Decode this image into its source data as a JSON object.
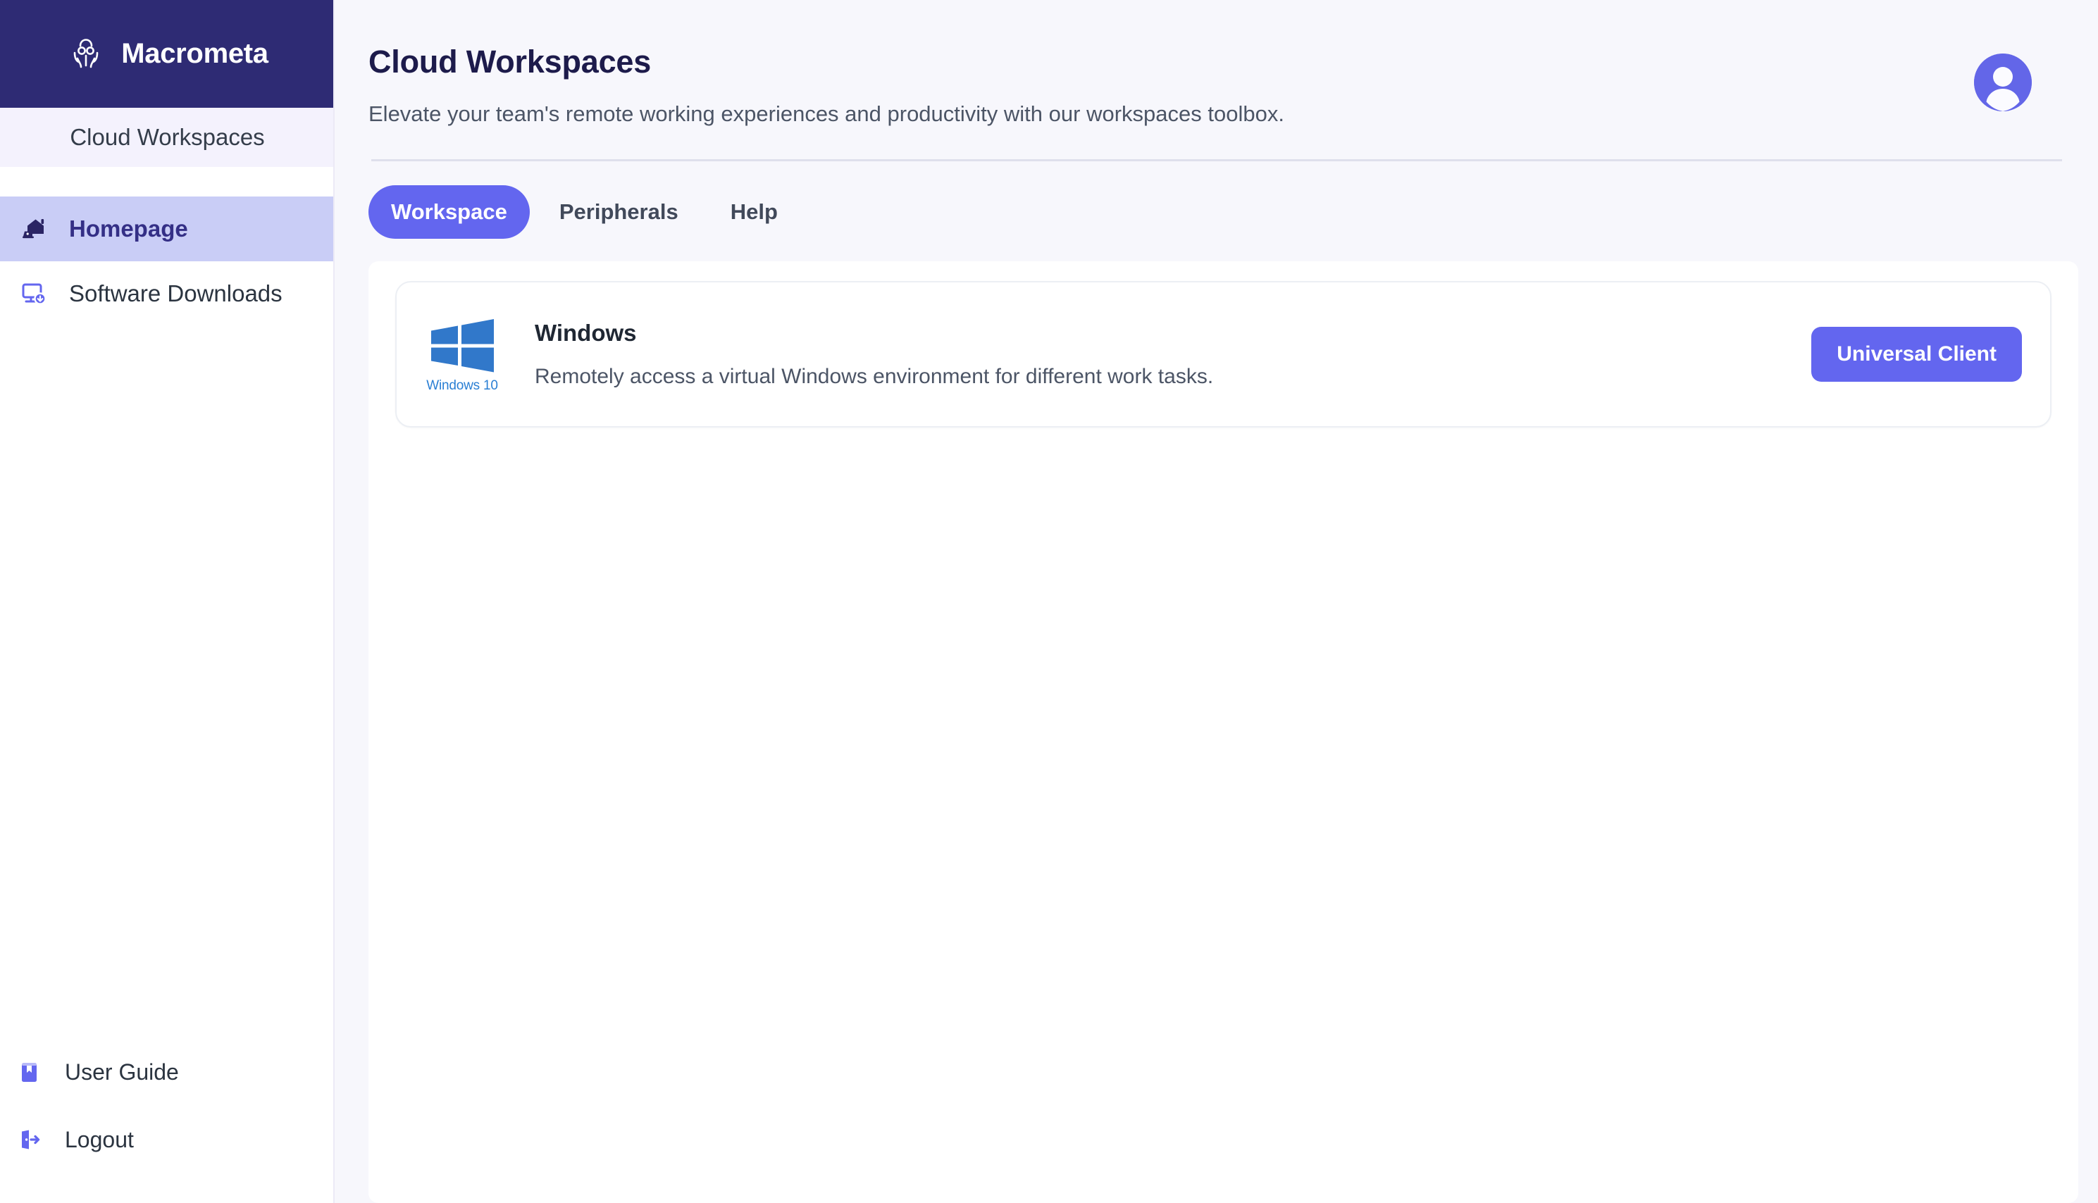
{
  "brand": {
    "name": "Macrometa",
    "logo_icon": "octopus-logo-icon",
    "background_color": "#2e2b74"
  },
  "sidebar": {
    "section_title": "Cloud Workspaces",
    "items": [
      {
        "label": "Homepage",
        "icon": "home-laptop-icon",
        "active": true
      },
      {
        "label": "Software Downloads",
        "icon": "monitor-download-icon",
        "active": false
      }
    ],
    "bottom_items": [
      {
        "label": "User Guide",
        "icon": "book-icon"
      },
      {
        "label": "Logout",
        "icon": "logout-door-icon"
      }
    ]
  },
  "header": {
    "title": "Cloud Workspaces",
    "subtitle": "Elevate your team's remote working experiences and productivity with our workspaces toolbox.",
    "avatar_icon": "user-avatar-icon",
    "avatar_color": "#6366e8"
  },
  "tabs": [
    {
      "label": "Workspace",
      "active": true
    },
    {
      "label": "Peripherals",
      "active": false
    },
    {
      "label": "Help",
      "active": false
    }
  ],
  "cards": [
    {
      "logo_icon": "windows-10-logo-icon",
      "logo_caption": "Windows 10",
      "title": "Windows",
      "description": "Remotely access a virtual Windows environment for different work tasks.",
      "action_label": "Universal Client"
    }
  ],
  "colors": {
    "accent": "#6366ef",
    "brand_dark": "#2e2b74",
    "active_nav": "#c9cdf6",
    "page_bg": "#f7f7fc",
    "windows_blue": "#2a7fd4"
  }
}
